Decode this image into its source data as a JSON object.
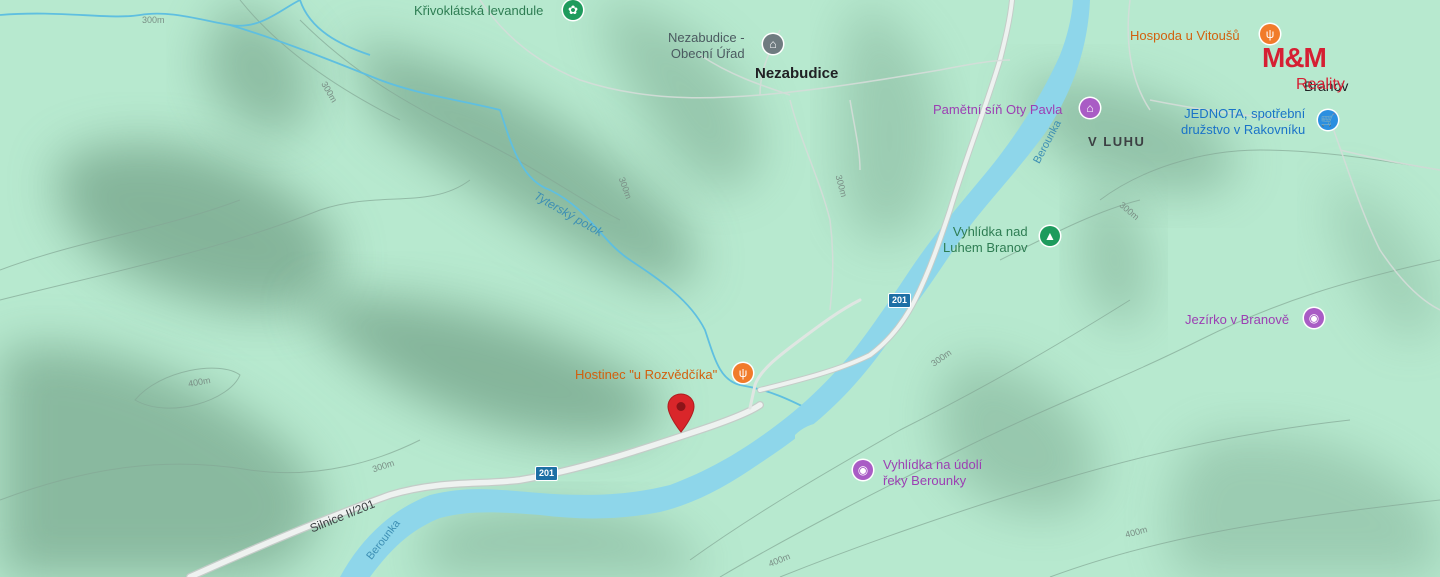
{
  "map": {
    "colors": {
      "land": "#b7e9cf",
      "shade": "#5c8a6f",
      "river": "#8ed6ea",
      "road": "#e6ece9",
      "marker": "#d9262a",
      "restaurant": "#f17b2a",
      "park": "#1e9b5d",
      "attraction": "#a95cc5",
      "shop": "#2b8fe0",
      "civic": "#6f7b80",
      "logo": "#d61f33"
    },
    "places": {
      "village": "Nezabudice",
      "locality": "V LUHU",
      "town": "Branov"
    },
    "pois": {
      "levandule": "Křivoklátská levandule",
      "urad_line1": "Nezabudice -",
      "urad_line2": "Obecní Úřad",
      "hospoda": "Hospoda u Vitoušů",
      "sin": "Pamětní síň Oty Pavla",
      "jednota_line1": "JEDNOTA, spotřební",
      "jednota_line2": "družstvo v Rakovníku",
      "vyhlidka_luh_line1": "Vyhlídka nad",
      "vyhlidka_luh_line2": "Luhem Branov",
      "jezirko": "Jezírko v Branově",
      "hostinec": "Hostinec \"u Rozvědčíka\"",
      "vyhlidka_udoli_line1": "Vyhlídka na údolí",
      "vyhlidka_udoli_line2": "řeky Berounky"
    },
    "water": {
      "stream": "Tyterský potok",
      "river": "Berounka"
    },
    "roads": {
      "road_name": "Silnice II/201",
      "shield": "201"
    },
    "contours": [
      "300m",
      "300m",
      "300m",
      "400m",
      "300m",
      "300m",
      "300m",
      "400m",
      "400m",
      "300m"
    ],
    "icons": {
      "levandule": "flower-icon",
      "urad": "government-building-icon",
      "hospoda": "restaurant-icon",
      "sin": "museum-icon",
      "jednota": "shopping-cart-icon",
      "vyhlidka_luh": "tree-icon",
      "jezirko": "camera-icon",
      "hostinec": "restaurant-icon",
      "vyhlidka_udoli": "camera-icon",
      "marker": "location-pin-icon"
    },
    "logo": {
      "main": "M&M",
      "sub": "Reality"
    }
  }
}
